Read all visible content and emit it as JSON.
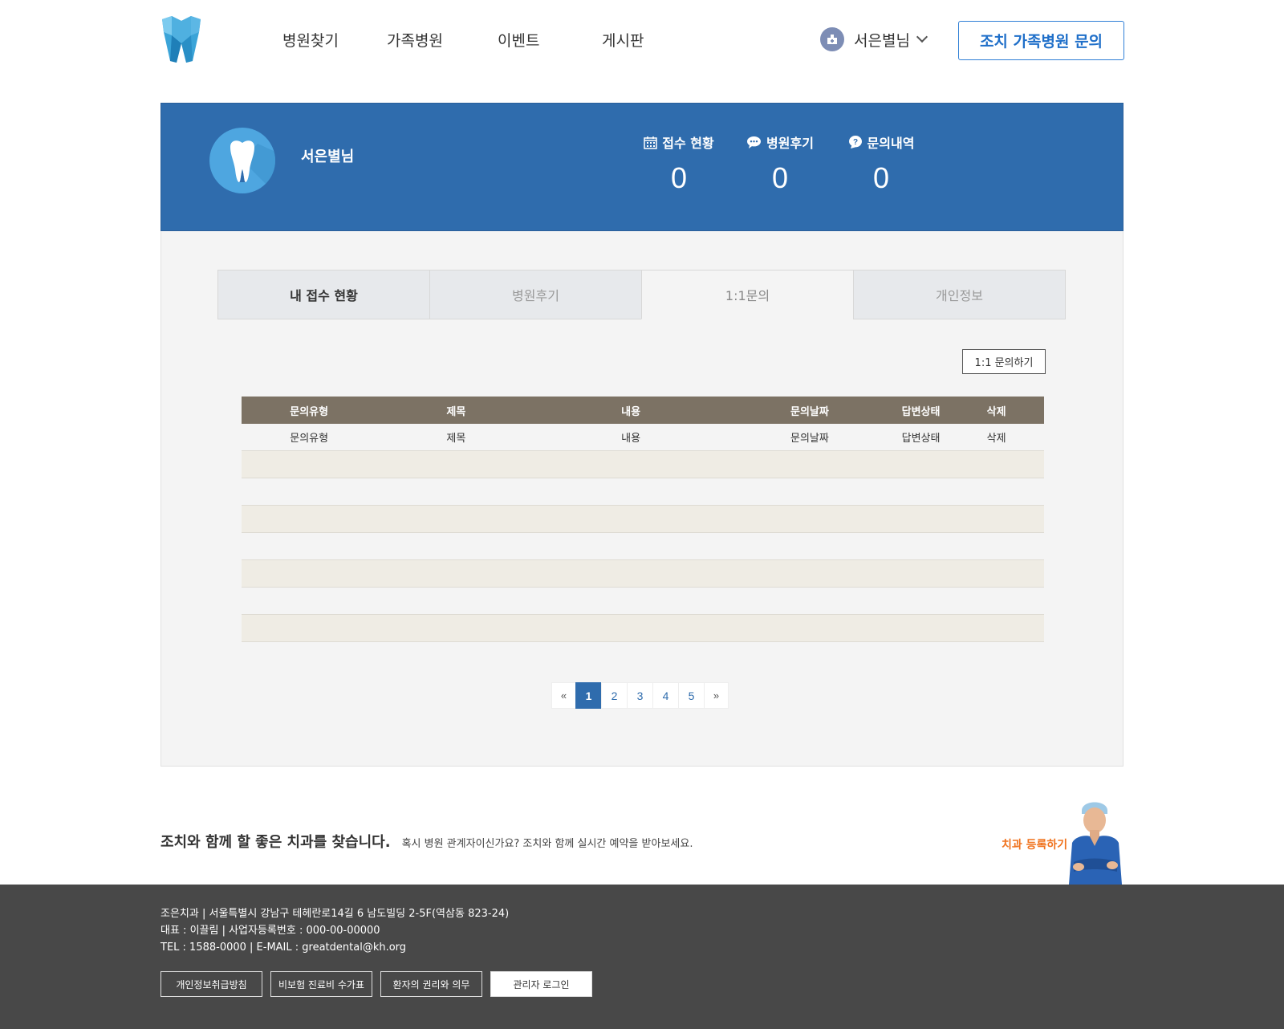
{
  "header": {
    "nav": [
      "병원찾기",
      "가족병원",
      "이벤트",
      "게시판"
    ],
    "user_name": "서은별님",
    "cta_label": "조치 가족병원 문의"
  },
  "banner": {
    "name": "서은별님",
    "stats": [
      {
        "label": "접수 현황",
        "value": "0",
        "icon": "calendar-icon"
      },
      {
        "label": "병원후기",
        "value": "0",
        "icon": "chat-bubble-icon"
      },
      {
        "label": "문의내역",
        "value": "0",
        "icon": "question-icon"
      }
    ]
  },
  "tabs": [
    "내 접수 현황",
    "병원후기",
    "1:1문의",
    "개인정보"
  ],
  "active_tab": "1:1문의",
  "inquiry_button": "1:1 문의하기",
  "table": {
    "headers": [
      "문의유형",
      "제목",
      "내용",
      "문의날짜",
      "답변상태",
      "삭제"
    ],
    "rows": [
      [
        "문의유형",
        "제목",
        "내용",
        "문의날짜",
        "답변상태",
        "삭제"
      ],
      [
        "",
        "",
        "",
        "",
        "",
        ""
      ],
      [
        "",
        "",
        "",
        "",
        "",
        ""
      ],
      [
        "",
        "",
        "",
        "",
        "",
        ""
      ],
      [
        "",
        "",
        "",
        "",
        "",
        ""
      ],
      [
        "",
        "",
        "",
        "",
        "",
        ""
      ],
      [
        "",
        "",
        "",
        "",
        "",
        ""
      ],
      [
        "",
        "",
        "",
        "",
        "",
        ""
      ]
    ]
  },
  "pagination": {
    "prev": "«",
    "pages": [
      "1",
      "2",
      "3",
      "4",
      "5"
    ],
    "current": "1",
    "next": "»"
  },
  "promo": {
    "title": "조치와 함께 할 좋은 치과를 찾습니다.",
    "subtitle": "혹시 병원 관계자이신가요?  조치와 함께 실시간 예약을 받아보세요.",
    "register_label": "치과 등록하기"
  },
  "footer": {
    "line1": "조은치과 | 서울특별시 강남구 테헤란로14길 6 남도빌딩 2-5F(역삼동 823-24)",
    "line2": "대표 : 이끌림 | 사업자등록번호 : 000-00-00000",
    "line3": "TEL : 1588-0000 | E-MAIL : greatdental@kh.org",
    "links": [
      "개인정보취급방침",
      "비보험 진료비 수가표",
      "환자의 권리와 의무",
      "관리자 로그인"
    ]
  },
  "colors": {
    "brand_blue": "#2f6cad",
    "table_header": "#7c7264",
    "row_shade": "#efece4",
    "accent_orange": "#f0731e",
    "footer_bg": "#484848"
  }
}
